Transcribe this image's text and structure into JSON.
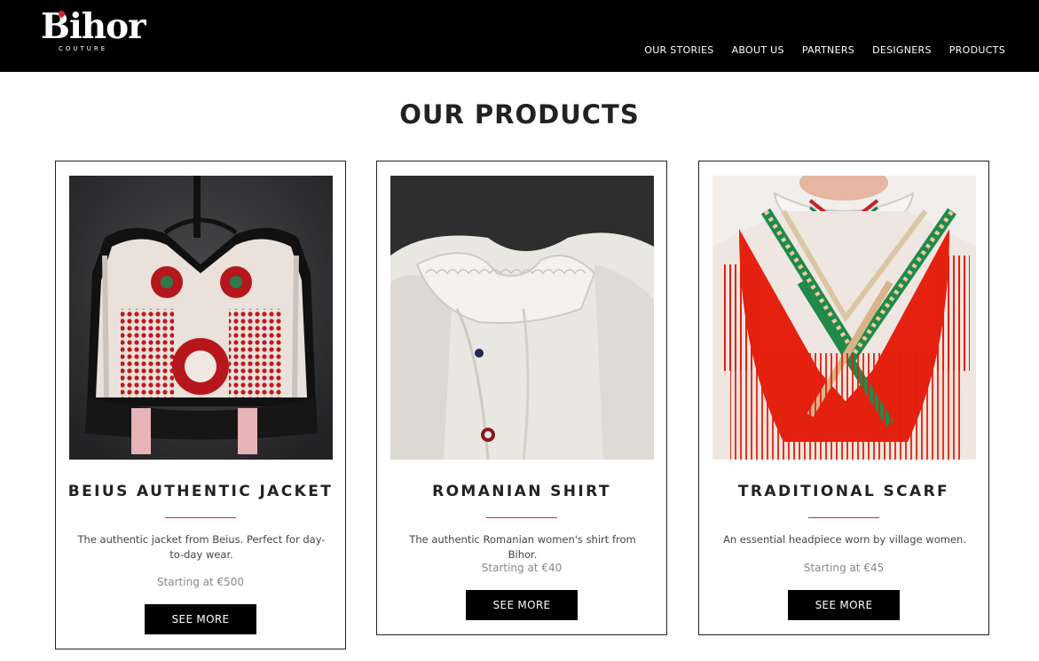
{
  "brand": {
    "name": "Bihor",
    "tagline": "COUTURE",
    "accent_color": "#d3232a"
  },
  "nav": {
    "items": [
      {
        "label": "OUR STORIES"
      },
      {
        "label": "ABOUT US"
      },
      {
        "label": "PARTNERS"
      },
      {
        "label": "DESIGNERS"
      },
      {
        "label": "PRODUCTS"
      }
    ]
  },
  "page": {
    "title": "OUR PRODUCTS"
  },
  "products": [
    {
      "name": "BEIUS AUTHENTIC JACKET",
      "description": "The authentic jacket from Beius. Perfect for day-to-day wear.",
      "price": "Starting at €500",
      "button_label": "SEE MORE",
      "image": "embroidered-vest-photo"
    },
    {
      "name": "ROMANIAN SHIRT",
      "description": "The authentic Romanian women's shirt from Bihor.",
      "price": "Starting at €40",
      "button_label": "SEE MORE",
      "image": "white-shirt-photo"
    },
    {
      "name": "TRADITIONAL SCARF",
      "description": "An essential headpiece worn by village women.",
      "price": "Starting at €45",
      "button_label": "SEE MORE",
      "image": "red-fringed-scarf-photo"
    }
  ]
}
